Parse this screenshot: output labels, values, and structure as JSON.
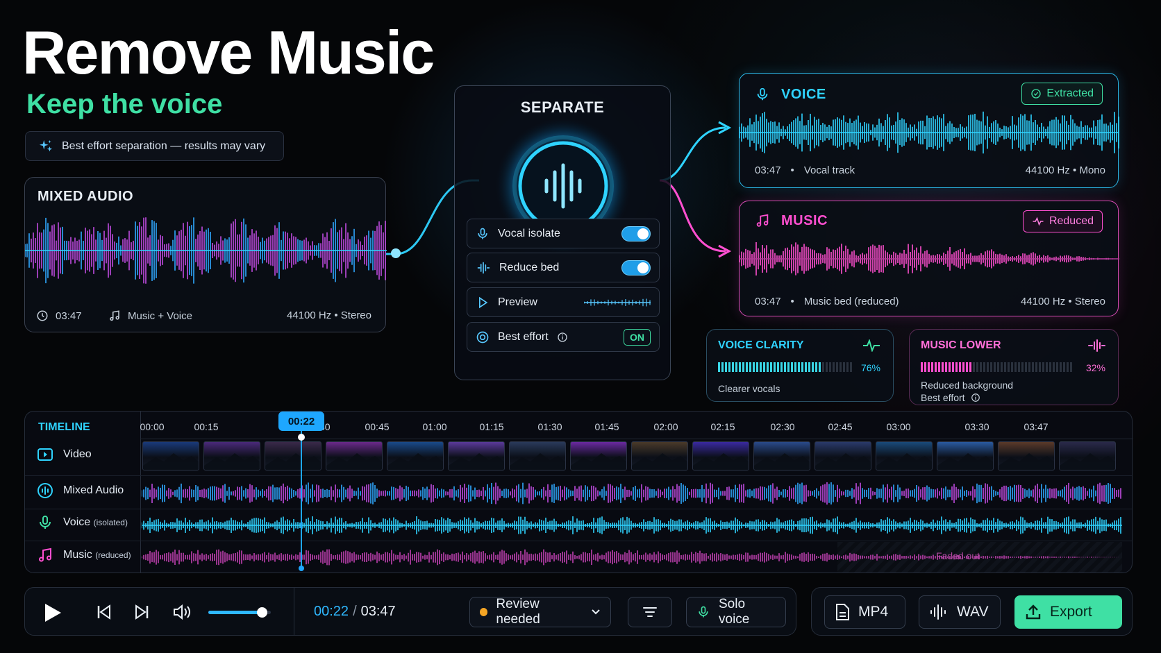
{
  "hero": {
    "title": "Remove Music",
    "subtitle": "Keep the voice",
    "note": "Best effort separation — results may vary"
  },
  "mixed": {
    "title": "MIXED AUDIO",
    "duration": "03:47",
    "content": "Music + Voice",
    "format": "44100 Hz • Stereo"
  },
  "separate": {
    "title": "SEPARATE",
    "rows": [
      {
        "label": "Vocal isolate",
        "state": "on"
      },
      {
        "label": "Reduce bed",
        "state": "on"
      },
      {
        "label": "Preview"
      },
      {
        "label": "Best effort",
        "badge": "ON"
      }
    ]
  },
  "voice": {
    "title": "VOICE",
    "badge": "Extracted",
    "duration": "03:47",
    "desc": "Vocal track",
    "format": "44100 Hz • Mono"
  },
  "music": {
    "title": "MUSIC",
    "badge": "Reduced",
    "duration": "03:47",
    "desc": "Music bed (reduced)",
    "format": "44100 Hz • Stereo"
  },
  "clarity": {
    "title": "VOICE CLARITY",
    "value": 0.76,
    "value_label": "76%",
    "caption": "Clearer vocals"
  },
  "lower": {
    "title": "MUSIC LOWER",
    "value": 0.32,
    "value_label": "32%",
    "caption1": "Reduced background",
    "caption2": "Best effort"
  },
  "timeline": {
    "title": "TIMELINE",
    "playhead": "00:22",
    "ticks": [
      "00:00",
      "00:15",
      "00:30",
      "00:45",
      "01:00",
      "01:15",
      "01:30",
      "01:45",
      "02:00",
      "02:15",
      "02:30",
      "02:45",
      "03:00",
      "03:30",
      "03:47"
    ],
    "tracks": [
      {
        "label": "Video",
        "suffix": ""
      },
      {
        "label": "Mixed Audio",
        "suffix": ""
      },
      {
        "label": "Voice",
        "suffix": "(isolated)"
      },
      {
        "label": "Music",
        "suffix": "(reduced)"
      }
    ],
    "faded_label": "Faded out"
  },
  "transport": {
    "current": "00:22",
    "separator": "/",
    "total": "03:47",
    "volume": 0.85
  },
  "status": {
    "label": "Review needed",
    "color": "#f5a524"
  },
  "solo": {
    "label": "Solo voice"
  },
  "export": {
    "mp4": "MP4",
    "wav": "WAV",
    "export": "Export"
  },
  "colors": {
    "voice": "#2fd3ff",
    "music": "#ff4fd0",
    "accent": "#3fe0a4",
    "brand_blue": "#1ea7ff"
  }
}
